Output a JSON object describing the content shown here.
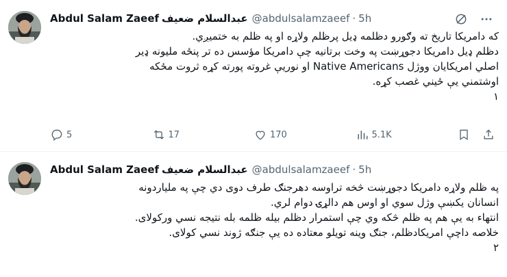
{
  "tweets": [
    {
      "author": {
        "name": "Abdul Salam Zaeef",
        "name_ar": "عبدالسلام ضعیف",
        "handle": "@abdulsalamzaeef",
        "time": "5h"
      },
      "lines": [
        "که دامریکا تاریخ ته وګورو دظلمه ډیل پرظلم ولاړه او په ظلم به ختمیږي.",
        "دظلم ډیل دامریکا دجوړښت په وخت برتانیه چې دامریکا مؤسس ده تر پنځه ملیونه ډیر",
        "اصلي امریکایان ووژل Native Americans او نوریې غروته پورته کړه ثروت مځکه",
        "اوشتمني یې ځیني غصب کړه.",
        "۱"
      ],
      "actions": {
        "replies": "5",
        "reposts": "17",
        "likes": "170",
        "views": "5.1K"
      }
    },
    {
      "author": {
        "name": "Abdul Salam Zaeef",
        "name_ar": "عبدالسلام ضعیف",
        "handle": "@abdulsalamzaeef",
        "time": "5h"
      },
      "lines": [
        "په ظلم ولاړه دامریکا دجوړښت څخه تراوسه دهرجنګ طرف دوی دي چې په ملیاردونه",
        "انسانان یکښې وژل سوي او اوس هم دالړۍ دوام لري.",
        "انتهاء به یې هم په ظلم څکه وي چې استمرار دظلم بیله ظلمه بله نتیجه نسي ورکولای.",
        "خلاصه داچې امریکادظلم، جنګ وینه تویلو معتاده ده یې جنګه ژوند نسي کولای.",
        "۲"
      ]
    }
  ]
}
